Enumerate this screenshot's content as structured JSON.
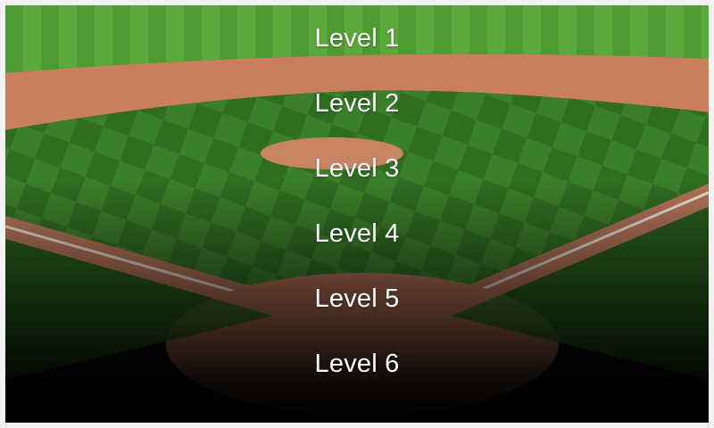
{
  "menu": {
    "levels": [
      {
        "label": "Level 1"
      },
      {
        "label": "Level 2"
      },
      {
        "label": "Level 3"
      },
      {
        "label": "Level 4"
      },
      {
        "label": "Level 5"
      },
      {
        "label": "Level 6"
      }
    ]
  },
  "theme": {
    "grass_light": "#4f9a2f",
    "grass_dark": "#2f6a1c",
    "dirt": "#c97f5d",
    "chalk": "#e7e1d6",
    "label_color": "#ffffff"
  }
}
